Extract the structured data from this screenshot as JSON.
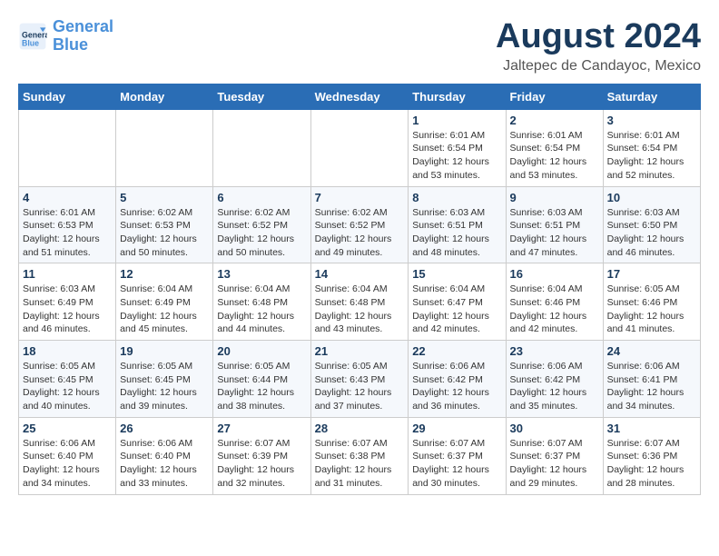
{
  "logo": {
    "name1": "General",
    "name2": "Blue"
  },
  "header": {
    "month_year": "August 2024",
    "location": "Jaltepec de Candayoc, Mexico"
  },
  "weekdays": [
    "Sunday",
    "Monday",
    "Tuesday",
    "Wednesday",
    "Thursday",
    "Friday",
    "Saturday"
  ],
  "weeks": [
    [
      {
        "day": "",
        "info": ""
      },
      {
        "day": "",
        "info": ""
      },
      {
        "day": "",
        "info": ""
      },
      {
        "day": "",
        "info": ""
      },
      {
        "day": "1",
        "info": "Sunrise: 6:01 AM\nSunset: 6:54 PM\nDaylight: 12 hours\nand 53 minutes."
      },
      {
        "day": "2",
        "info": "Sunrise: 6:01 AM\nSunset: 6:54 PM\nDaylight: 12 hours\nand 53 minutes."
      },
      {
        "day": "3",
        "info": "Sunrise: 6:01 AM\nSunset: 6:54 PM\nDaylight: 12 hours\nand 52 minutes."
      }
    ],
    [
      {
        "day": "4",
        "info": "Sunrise: 6:01 AM\nSunset: 6:53 PM\nDaylight: 12 hours\nand 51 minutes."
      },
      {
        "day": "5",
        "info": "Sunrise: 6:02 AM\nSunset: 6:53 PM\nDaylight: 12 hours\nand 50 minutes."
      },
      {
        "day": "6",
        "info": "Sunrise: 6:02 AM\nSunset: 6:52 PM\nDaylight: 12 hours\nand 50 minutes."
      },
      {
        "day": "7",
        "info": "Sunrise: 6:02 AM\nSunset: 6:52 PM\nDaylight: 12 hours\nand 49 minutes."
      },
      {
        "day": "8",
        "info": "Sunrise: 6:03 AM\nSunset: 6:51 PM\nDaylight: 12 hours\nand 48 minutes."
      },
      {
        "day": "9",
        "info": "Sunrise: 6:03 AM\nSunset: 6:51 PM\nDaylight: 12 hours\nand 47 minutes."
      },
      {
        "day": "10",
        "info": "Sunrise: 6:03 AM\nSunset: 6:50 PM\nDaylight: 12 hours\nand 46 minutes."
      }
    ],
    [
      {
        "day": "11",
        "info": "Sunrise: 6:03 AM\nSunset: 6:49 PM\nDaylight: 12 hours\nand 46 minutes."
      },
      {
        "day": "12",
        "info": "Sunrise: 6:04 AM\nSunset: 6:49 PM\nDaylight: 12 hours\nand 45 minutes."
      },
      {
        "day": "13",
        "info": "Sunrise: 6:04 AM\nSunset: 6:48 PM\nDaylight: 12 hours\nand 44 minutes."
      },
      {
        "day": "14",
        "info": "Sunrise: 6:04 AM\nSunset: 6:48 PM\nDaylight: 12 hours\nand 43 minutes."
      },
      {
        "day": "15",
        "info": "Sunrise: 6:04 AM\nSunset: 6:47 PM\nDaylight: 12 hours\nand 42 minutes."
      },
      {
        "day": "16",
        "info": "Sunrise: 6:04 AM\nSunset: 6:46 PM\nDaylight: 12 hours\nand 42 minutes."
      },
      {
        "day": "17",
        "info": "Sunrise: 6:05 AM\nSunset: 6:46 PM\nDaylight: 12 hours\nand 41 minutes."
      }
    ],
    [
      {
        "day": "18",
        "info": "Sunrise: 6:05 AM\nSunset: 6:45 PM\nDaylight: 12 hours\nand 40 minutes."
      },
      {
        "day": "19",
        "info": "Sunrise: 6:05 AM\nSunset: 6:45 PM\nDaylight: 12 hours\nand 39 minutes."
      },
      {
        "day": "20",
        "info": "Sunrise: 6:05 AM\nSunset: 6:44 PM\nDaylight: 12 hours\nand 38 minutes."
      },
      {
        "day": "21",
        "info": "Sunrise: 6:05 AM\nSunset: 6:43 PM\nDaylight: 12 hours\nand 37 minutes."
      },
      {
        "day": "22",
        "info": "Sunrise: 6:06 AM\nSunset: 6:42 PM\nDaylight: 12 hours\nand 36 minutes."
      },
      {
        "day": "23",
        "info": "Sunrise: 6:06 AM\nSunset: 6:42 PM\nDaylight: 12 hours\nand 35 minutes."
      },
      {
        "day": "24",
        "info": "Sunrise: 6:06 AM\nSunset: 6:41 PM\nDaylight: 12 hours\nand 34 minutes."
      }
    ],
    [
      {
        "day": "25",
        "info": "Sunrise: 6:06 AM\nSunset: 6:40 PM\nDaylight: 12 hours\nand 34 minutes."
      },
      {
        "day": "26",
        "info": "Sunrise: 6:06 AM\nSunset: 6:40 PM\nDaylight: 12 hours\nand 33 minutes."
      },
      {
        "day": "27",
        "info": "Sunrise: 6:07 AM\nSunset: 6:39 PM\nDaylight: 12 hours\nand 32 minutes."
      },
      {
        "day": "28",
        "info": "Sunrise: 6:07 AM\nSunset: 6:38 PM\nDaylight: 12 hours\nand 31 minutes."
      },
      {
        "day": "29",
        "info": "Sunrise: 6:07 AM\nSunset: 6:37 PM\nDaylight: 12 hours\nand 30 minutes."
      },
      {
        "day": "30",
        "info": "Sunrise: 6:07 AM\nSunset: 6:37 PM\nDaylight: 12 hours\nand 29 minutes."
      },
      {
        "day": "31",
        "info": "Sunrise: 6:07 AM\nSunset: 6:36 PM\nDaylight: 12 hours\nand 28 minutes."
      }
    ]
  ]
}
